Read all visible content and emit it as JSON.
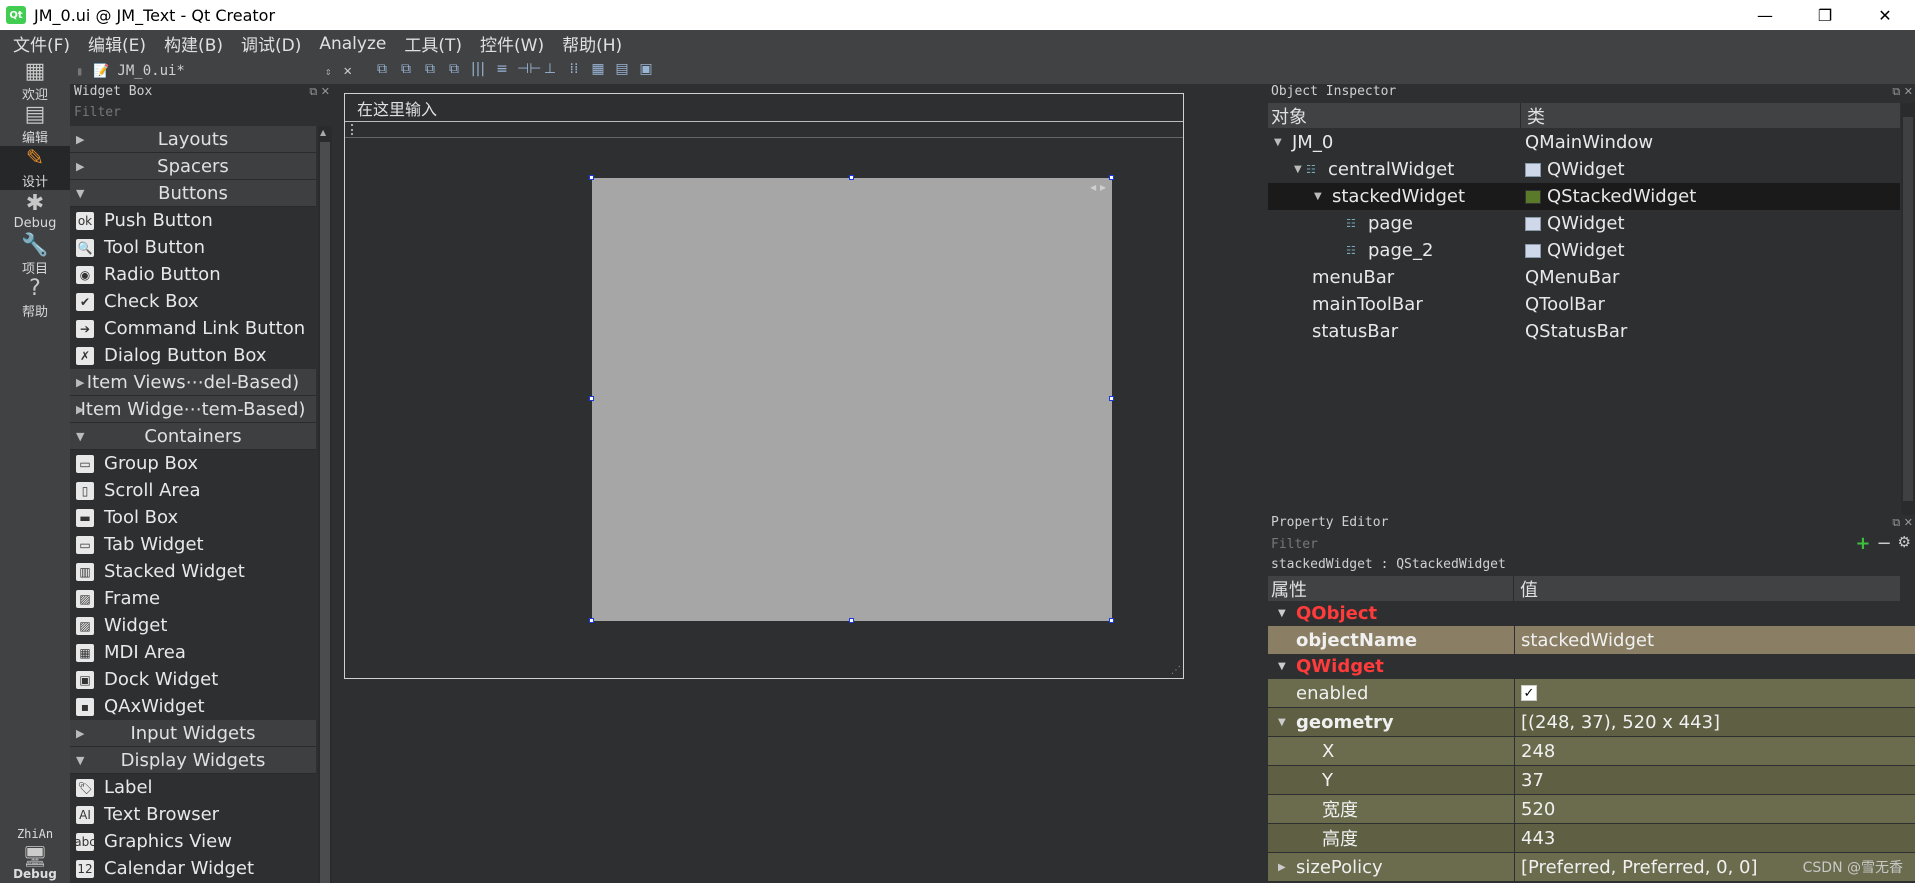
{
  "window": {
    "title": "JM_0.ui @ JM_Text - Qt Creator",
    "app_icon": "Qt",
    "minimize": "—",
    "restore": "❐",
    "close": "✕"
  },
  "menubar": {
    "items": [
      "文件(F)",
      "编辑(E)",
      "构建(B)",
      "调试(D)",
      "Analyze",
      "工具(T)",
      "控件(W)",
      "帮助(H)"
    ]
  },
  "modes": [
    {
      "label": "欢迎",
      "icon": "grid-icon",
      "glyph": "▦"
    },
    {
      "label": "编辑",
      "icon": "edit-doc-icon",
      "glyph": "▤"
    },
    {
      "label": "设计",
      "icon": "pencil-icon",
      "glyph": "✎"
    },
    {
      "label": "Debug",
      "icon": "bug-icon",
      "glyph": "✱"
    },
    {
      "label": "项目",
      "icon": "wrench-icon",
      "glyph": "🔧"
    },
    {
      "label": "帮助",
      "icon": "help-icon",
      "glyph": "?"
    }
  ],
  "kit": {
    "name": "ZhiAn",
    "mode": "Debug"
  },
  "editor_tab": {
    "filename": "JM_0.ui*"
  },
  "widget_box": {
    "title": "Widget Box",
    "filter_placeholder": "Filter",
    "items": [
      {
        "type": "cat",
        "label": "Layouts",
        "expanded": false
      },
      {
        "type": "cat",
        "label": "Spacers",
        "expanded": false
      },
      {
        "type": "cat",
        "label": "Buttons",
        "expanded": true
      },
      {
        "type": "item",
        "label": "Push Button",
        "icon": "ok"
      },
      {
        "type": "item",
        "label": "Tool Button",
        "icon": "🔍"
      },
      {
        "type": "item",
        "label": "Radio Button",
        "icon": "◉"
      },
      {
        "type": "item",
        "label": "Check Box",
        "icon": "✔"
      },
      {
        "type": "item",
        "label": "Command Link Button",
        "icon": "➔"
      },
      {
        "type": "item",
        "label": "Dialog Button Box",
        "icon": "✗"
      },
      {
        "type": "cat",
        "label": "Item Views⋯del-Based)",
        "expanded": false
      },
      {
        "type": "cat",
        "label": "Item Widge⋯tem-Based)",
        "expanded": false
      },
      {
        "type": "cat",
        "label": "Containers",
        "expanded": true
      },
      {
        "type": "item",
        "label": "Group Box",
        "icon": "▭"
      },
      {
        "type": "item",
        "label": "Scroll Area",
        "icon": "▯"
      },
      {
        "type": "item",
        "label": "Tool Box",
        "icon": "▬"
      },
      {
        "type": "item",
        "label": "Tab Widget",
        "icon": "▭"
      },
      {
        "type": "item",
        "label": "Stacked Widget",
        "icon": "▥"
      },
      {
        "type": "item",
        "label": "Frame",
        "icon": "▨"
      },
      {
        "type": "item",
        "label": "Widget",
        "icon": "▨"
      },
      {
        "type": "item",
        "label": "MDI Area",
        "icon": "▦"
      },
      {
        "type": "item",
        "label": "Dock Widget",
        "icon": "▣"
      },
      {
        "type": "item",
        "label": "QAxWidget",
        "icon": "▪"
      },
      {
        "type": "cat",
        "label": "Input Widgets",
        "expanded": false
      },
      {
        "type": "cat",
        "label": "Display Widgets",
        "expanded": true
      },
      {
        "type": "item",
        "label": "Label",
        "icon": "🏷"
      },
      {
        "type": "item",
        "label": "Text Browser",
        "icon": "AI"
      },
      {
        "type": "item",
        "label": "Graphics View",
        "icon": "abc"
      },
      {
        "type": "item",
        "label": "Calendar Widget",
        "icon": "12"
      }
    ]
  },
  "form": {
    "menu_placeholder": "在这里输入"
  },
  "object_inspector": {
    "title": "Object Inspector",
    "col_object": "对象",
    "col_class": "类",
    "rows": [
      {
        "object": "JM_0",
        "class": "QMainWindow",
        "depth": 0,
        "arrow": "▼",
        "has_icon": false,
        "class_icon": false,
        "selected": false
      },
      {
        "object": "centralWidget",
        "class": "QWidget",
        "depth": 1,
        "arrow": "▼",
        "has_icon": true,
        "class_icon": true,
        "selected": false
      },
      {
        "object": "stackedWidget",
        "class": "QStackedWidget",
        "depth": 2,
        "arrow": "▼",
        "has_icon": false,
        "class_icon": true,
        "selected": true
      },
      {
        "object": "page",
        "class": "QWidget",
        "depth": 3,
        "arrow": "",
        "has_icon": true,
        "class_icon": true,
        "selected": false
      },
      {
        "object": "page_2",
        "class": "QWidget",
        "depth": 3,
        "arrow": "",
        "has_icon": true,
        "class_icon": true,
        "selected": false
      },
      {
        "object": "menuBar",
        "class": "QMenuBar",
        "depth": 1,
        "arrow": "",
        "has_icon": false,
        "class_icon": false,
        "selected": false
      },
      {
        "object": "mainToolBar",
        "class": "QToolBar",
        "depth": 1,
        "arrow": "",
        "has_icon": false,
        "class_icon": false,
        "selected": false
      },
      {
        "object": "statusBar",
        "class": "QStatusBar",
        "depth": 1,
        "arrow": "",
        "has_icon": false,
        "class_icon": false,
        "selected": false
      }
    ]
  },
  "property_editor": {
    "title": "Property Editor",
    "filter_placeholder": "Filter",
    "class_line": "stackedWidget : QStackedWidget",
    "col_property": "属性",
    "col_value": "值",
    "add_button": "+",
    "remove_button": "−",
    "config_button": "⚙",
    "rows": [
      {
        "kind": "group",
        "name": "QObject",
        "value": ""
      },
      {
        "kind": "prop",
        "name": "objectName",
        "value": "stackedWidget",
        "style": "khaki bold"
      },
      {
        "kind": "group",
        "name": "QWidget",
        "value": ""
      },
      {
        "kind": "check",
        "name": "enabled",
        "value": "✓",
        "style": "olive"
      },
      {
        "kind": "prop",
        "name": "geometry",
        "value": "[(248, 37), 520 x 443]",
        "style": "olive2 bold",
        "arrow": "▼"
      },
      {
        "kind": "prop",
        "name": "X",
        "value": "248",
        "style": "olive sub"
      },
      {
        "kind": "prop",
        "name": "Y",
        "value": "37",
        "style": "olive2 sub"
      },
      {
        "kind": "prop",
        "name": "宽度",
        "value": "520",
        "style": "olive sub"
      },
      {
        "kind": "prop",
        "name": "高度",
        "value": "443",
        "style": "olive2 sub"
      },
      {
        "kind": "prop",
        "name": "sizePolicy",
        "value": "[Preferred, Preferred, 0, 0]",
        "style": "olive",
        "arrow": "▶"
      }
    ]
  },
  "watermark": "CSDN @雪无香"
}
